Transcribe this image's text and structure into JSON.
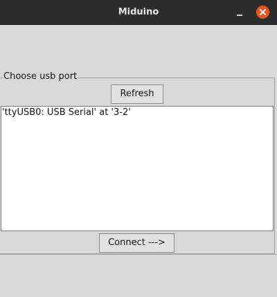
{
  "window": {
    "title": "Miduino",
    "controls": {
      "minimize_icon": "minimize-icon",
      "close_icon": "close-icon",
      "close_color": "#e95420"
    }
  },
  "port_frame": {
    "label": "Choose usb port",
    "refresh_label": "Refresh",
    "ports": [
      "'ttyUSB0: USB Serial' at '3-2'"
    ],
    "connect_label": "Connect --->"
  }
}
